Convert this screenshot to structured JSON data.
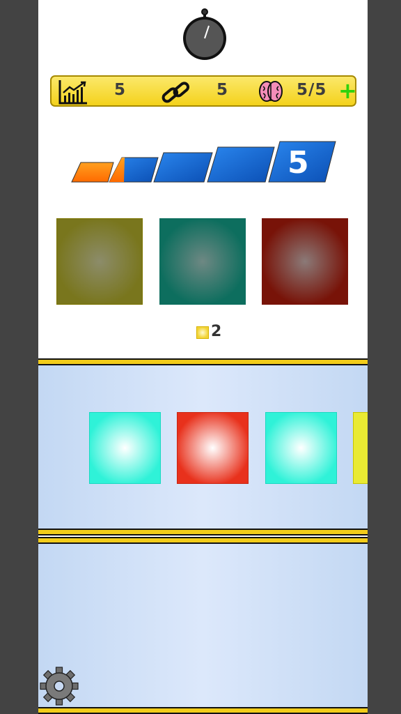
{
  "stats": {
    "score": "5",
    "chain": "5",
    "lives": "5/5",
    "add_label": "+"
  },
  "level": {
    "current": "5",
    "steps": 5,
    "progress_fraction": 0.2
  },
  "gems": {
    "count": "2"
  },
  "targets": [
    {
      "name": "olive",
      "color": "#79761d"
    },
    {
      "name": "teal",
      "color": "#0d6e5e"
    },
    {
      "name": "maroon",
      "color": "#781308"
    }
  ],
  "conveyor": [
    {
      "color": "#2ff2d8"
    },
    {
      "color": "#e8311c"
    },
    {
      "color": "#2ff2d8"
    },
    {
      "color": "#e9ea33"
    }
  ],
  "icons": {
    "timer": "stopwatch-icon",
    "score": "chart-icon",
    "chain": "link-icon",
    "lives": "brain-icon",
    "settings": "gear-icon"
  },
  "colors": {
    "bar": "#f4d21c",
    "accent": "#1565c0",
    "progress": "#ff7a00"
  }
}
